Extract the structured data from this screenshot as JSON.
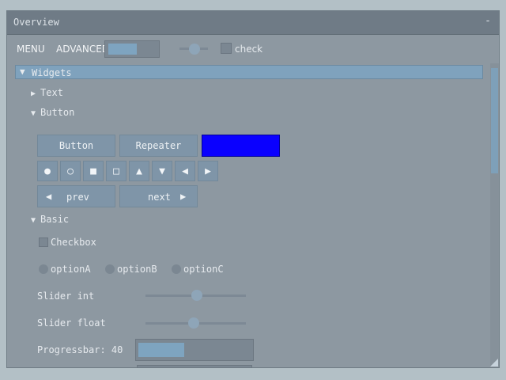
{
  "window": {
    "title": "Overview",
    "minimize_glyph": "-"
  },
  "menubar": {
    "menu_label": "MENU",
    "advanced_label": "ADVANCED",
    "check_label": "check"
  },
  "tree": {
    "widgets": "Widgets",
    "text": "Text",
    "button": "Button",
    "basic": "Basic",
    "arrow_open": "▼",
    "arrow_closed": "▶"
  },
  "buttons": {
    "button_label": "Button",
    "repeater_label": "Repeater",
    "blue_color": "#0a00ff",
    "icons": [
      "●",
      "○",
      "■",
      "□",
      "▲",
      "▼",
      "◀",
      "▶"
    ],
    "prev_label": "prev",
    "next_label": "next",
    "prev_glyph": "◀",
    "next_glyph": "▶"
  },
  "basic": {
    "checkbox_label": "Checkbox",
    "options": [
      "optionA",
      "optionB",
      "optionC"
    ],
    "slider_int_label": "Slider int",
    "slider_float_label": "Slider float",
    "progressbar_label": "Progressbar: 40",
    "progress_fraction": 0.4
  }
}
